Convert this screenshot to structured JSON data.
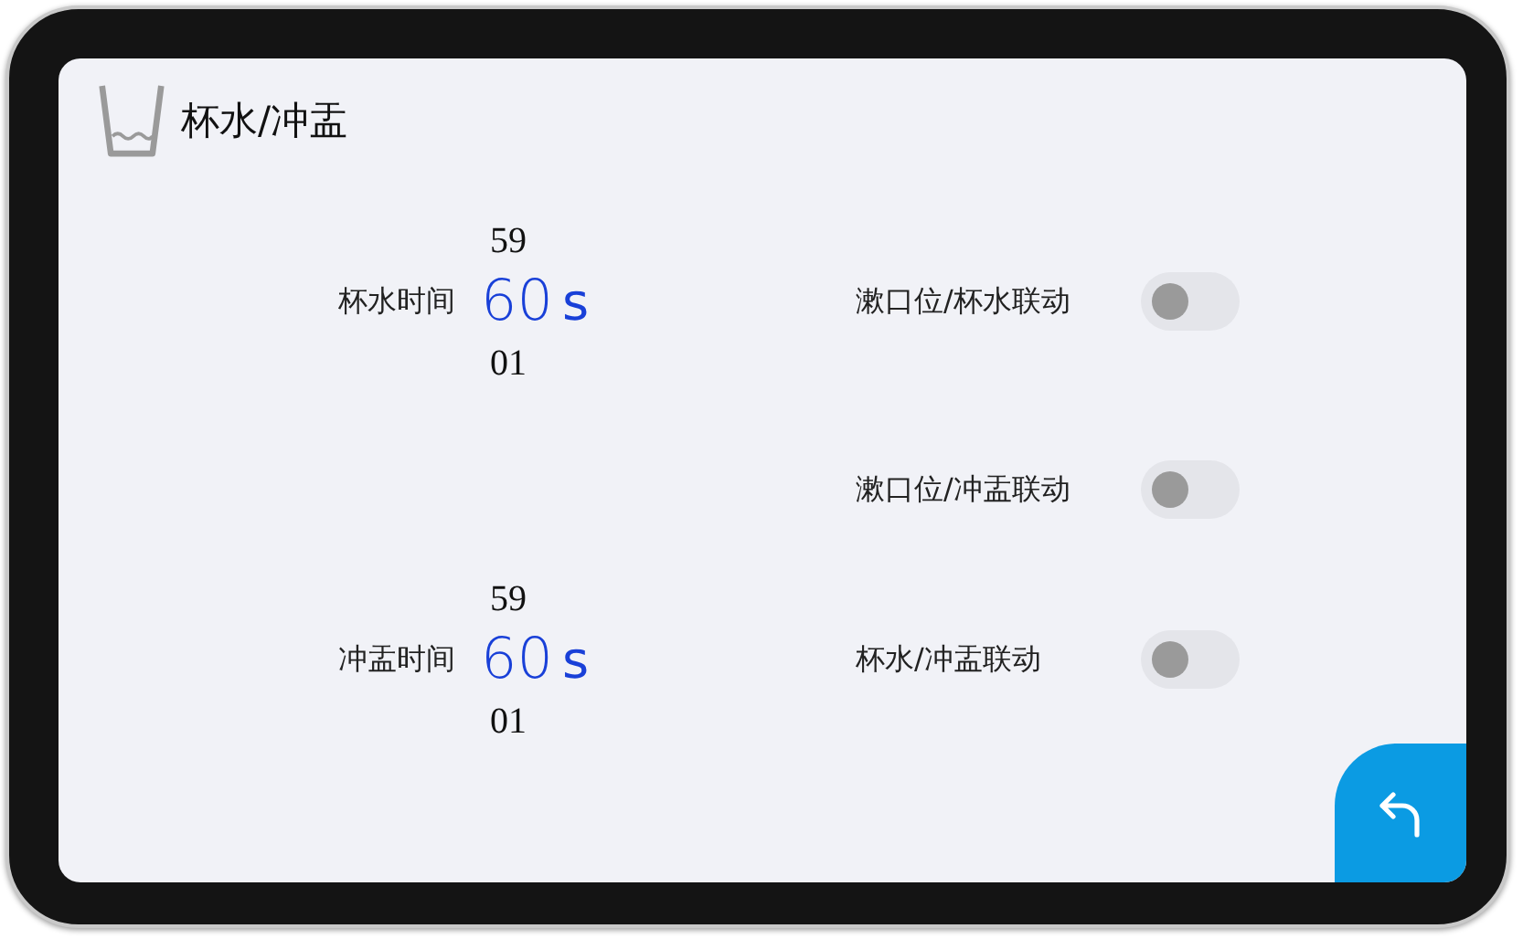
{
  "header": {
    "title": "杯水/冲盂"
  },
  "timers": [
    {
      "label": "杯水时间",
      "prev": "59",
      "value": "60",
      "unit": "s",
      "next": "01"
    },
    {
      "label": "冲盂时间",
      "prev": "59",
      "value": "60",
      "unit": "s",
      "next": "01"
    }
  ],
  "toggles": [
    {
      "label": "漱口位/杯水联动",
      "on": false
    },
    {
      "label": "漱口位/冲盂联动",
      "on": false
    },
    {
      "label": "杯水/冲盂联动",
      "on": false
    }
  ]
}
